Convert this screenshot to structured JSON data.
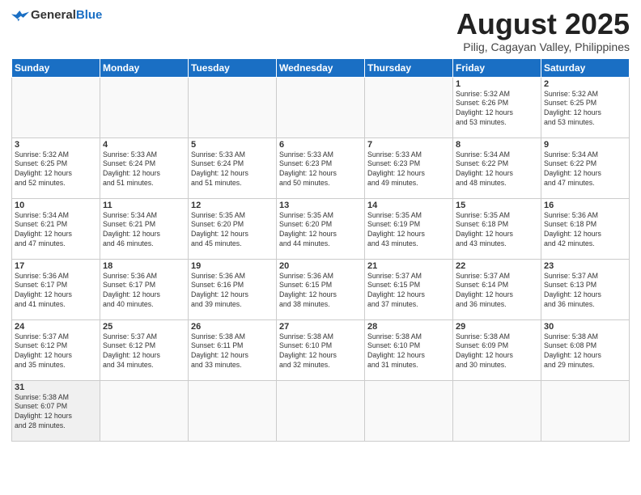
{
  "logo": {
    "general": "General",
    "blue": "Blue"
  },
  "title": {
    "month_year": "August 2025",
    "location": "Pilig, Cagayan Valley, Philippines"
  },
  "days_of_week": [
    "Sunday",
    "Monday",
    "Tuesday",
    "Wednesday",
    "Thursday",
    "Friday",
    "Saturday"
  ],
  "weeks": [
    [
      {
        "day": "",
        "info": ""
      },
      {
        "day": "",
        "info": ""
      },
      {
        "day": "",
        "info": ""
      },
      {
        "day": "",
        "info": ""
      },
      {
        "day": "",
        "info": ""
      },
      {
        "day": "1",
        "info": "Sunrise: 5:32 AM\nSunset: 6:26 PM\nDaylight: 12 hours\nand 53 minutes."
      },
      {
        "day": "2",
        "info": "Sunrise: 5:32 AM\nSunset: 6:25 PM\nDaylight: 12 hours\nand 53 minutes."
      }
    ],
    [
      {
        "day": "3",
        "info": "Sunrise: 5:32 AM\nSunset: 6:25 PM\nDaylight: 12 hours\nand 52 minutes."
      },
      {
        "day": "4",
        "info": "Sunrise: 5:33 AM\nSunset: 6:24 PM\nDaylight: 12 hours\nand 51 minutes."
      },
      {
        "day": "5",
        "info": "Sunrise: 5:33 AM\nSunset: 6:24 PM\nDaylight: 12 hours\nand 51 minutes."
      },
      {
        "day": "6",
        "info": "Sunrise: 5:33 AM\nSunset: 6:23 PM\nDaylight: 12 hours\nand 50 minutes."
      },
      {
        "day": "7",
        "info": "Sunrise: 5:33 AM\nSunset: 6:23 PM\nDaylight: 12 hours\nand 49 minutes."
      },
      {
        "day": "8",
        "info": "Sunrise: 5:34 AM\nSunset: 6:22 PM\nDaylight: 12 hours\nand 48 minutes."
      },
      {
        "day": "9",
        "info": "Sunrise: 5:34 AM\nSunset: 6:22 PM\nDaylight: 12 hours\nand 47 minutes."
      }
    ],
    [
      {
        "day": "10",
        "info": "Sunrise: 5:34 AM\nSunset: 6:21 PM\nDaylight: 12 hours\nand 47 minutes."
      },
      {
        "day": "11",
        "info": "Sunrise: 5:34 AM\nSunset: 6:21 PM\nDaylight: 12 hours\nand 46 minutes."
      },
      {
        "day": "12",
        "info": "Sunrise: 5:35 AM\nSunset: 6:20 PM\nDaylight: 12 hours\nand 45 minutes."
      },
      {
        "day": "13",
        "info": "Sunrise: 5:35 AM\nSunset: 6:20 PM\nDaylight: 12 hours\nand 44 minutes."
      },
      {
        "day": "14",
        "info": "Sunrise: 5:35 AM\nSunset: 6:19 PM\nDaylight: 12 hours\nand 43 minutes."
      },
      {
        "day": "15",
        "info": "Sunrise: 5:35 AM\nSunset: 6:18 PM\nDaylight: 12 hours\nand 43 minutes."
      },
      {
        "day": "16",
        "info": "Sunrise: 5:36 AM\nSunset: 6:18 PM\nDaylight: 12 hours\nand 42 minutes."
      }
    ],
    [
      {
        "day": "17",
        "info": "Sunrise: 5:36 AM\nSunset: 6:17 PM\nDaylight: 12 hours\nand 41 minutes."
      },
      {
        "day": "18",
        "info": "Sunrise: 5:36 AM\nSunset: 6:17 PM\nDaylight: 12 hours\nand 40 minutes."
      },
      {
        "day": "19",
        "info": "Sunrise: 5:36 AM\nSunset: 6:16 PM\nDaylight: 12 hours\nand 39 minutes."
      },
      {
        "day": "20",
        "info": "Sunrise: 5:36 AM\nSunset: 6:15 PM\nDaylight: 12 hours\nand 38 minutes."
      },
      {
        "day": "21",
        "info": "Sunrise: 5:37 AM\nSunset: 6:15 PM\nDaylight: 12 hours\nand 37 minutes."
      },
      {
        "day": "22",
        "info": "Sunrise: 5:37 AM\nSunset: 6:14 PM\nDaylight: 12 hours\nand 36 minutes."
      },
      {
        "day": "23",
        "info": "Sunrise: 5:37 AM\nSunset: 6:13 PM\nDaylight: 12 hours\nand 36 minutes."
      }
    ],
    [
      {
        "day": "24",
        "info": "Sunrise: 5:37 AM\nSunset: 6:12 PM\nDaylight: 12 hours\nand 35 minutes."
      },
      {
        "day": "25",
        "info": "Sunrise: 5:37 AM\nSunset: 6:12 PM\nDaylight: 12 hours\nand 34 minutes."
      },
      {
        "day": "26",
        "info": "Sunrise: 5:38 AM\nSunset: 6:11 PM\nDaylight: 12 hours\nand 33 minutes."
      },
      {
        "day": "27",
        "info": "Sunrise: 5:38 AM\nSunset: 6:10 PM\nDaylight: 12 hours\nand 32 minutes."
      },
      {
        "day": "28",
        "info": "Sunrise: 5:38 AM\nSunset: 6:10 PM\nDaylight: 12 hours\nand 31 minutes."
      },
      {
        "day": "29",
        "info": "Sunrise: 5:38 AM\nSunset: 6:09 PM\nDaylight: 12 hours\nand 30 minutes."
      },
      {
        "day": "30",
        "info": "Sunrise: 5:38 AM\nSunset: 6:08 PM\nDaylight: 12 hours\nand 29 minutes."
      }
    ],
    [
      {
        "day": "31",
        "info": "Sunrise: 5:38 AM\nSunset: 6:07 PM\nDaylight: 12 hours\nand 28 minutes."
      },
      {
        "day": "",
        "info": ""
      },
      {
        "day": "",
        "info": ""
      },
      {
        "day": "",
        "info": ""
      },
      {
        "day": "",
        "info": ""
      },
      {
        "day": "",
        "info": ""
      },
      {
        "day": "",
        "info": ""
      }
    ]
  ]
}
